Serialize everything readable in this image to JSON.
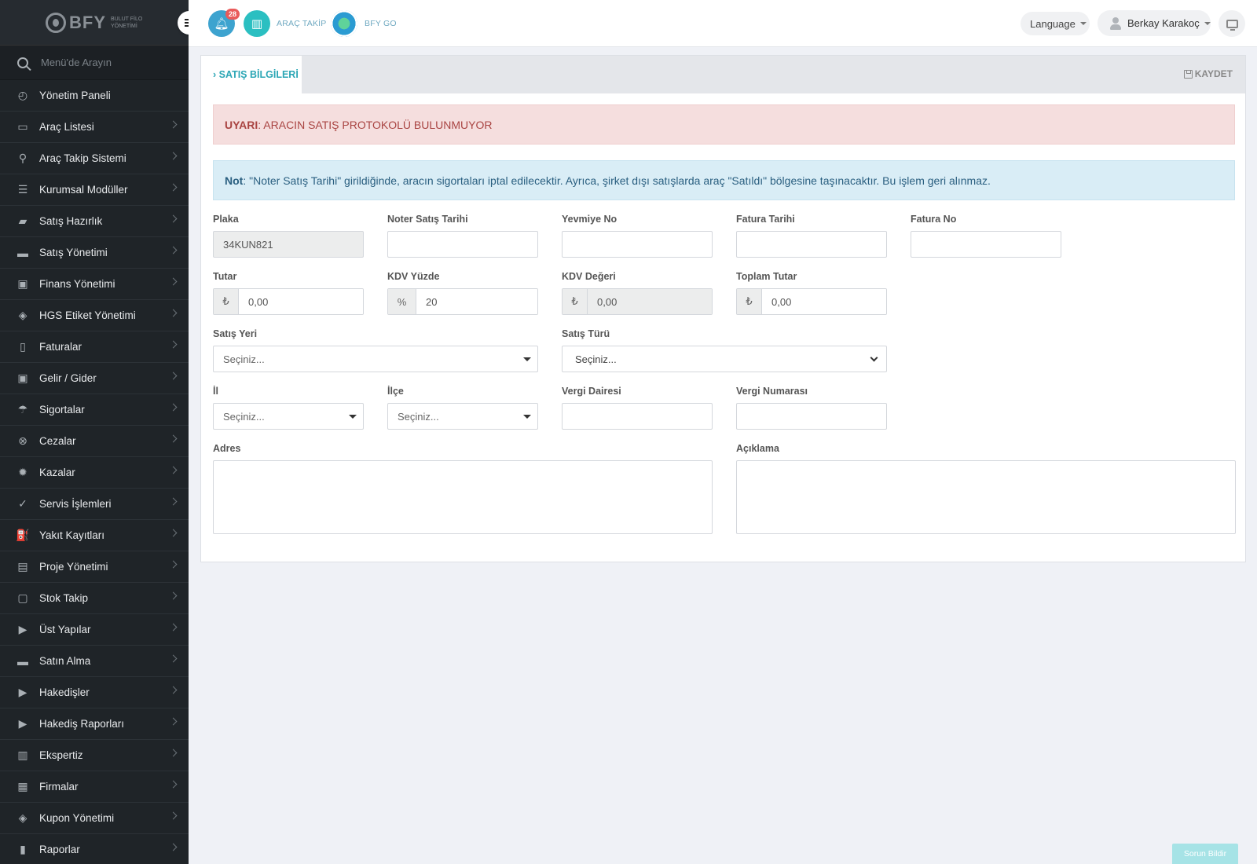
{
  "brand": {
    "name": "BFY",
    "sub_line1": "BULUT FİLO",
    "sub_line2": "YÖNETİMİ"
  },
  "sidebar": {
    "search_placeholder": "Menü'de Arayın",
    "items": [
      {
        "label": "Yönetim Paneli",
        "icon": "dashboard-icon",
        "glyph": "◴"
      },
      {
        "label": "Araç Listesi",
        "icon": "bus-icon",
        "glyph": "▭"
      },
      {
        "label": "Araç Takip Sistemi",
        "icon": "map-marker-icon",
        "glyph": "⚲"
      },
      {
        "label": "Kurumsal Modüller",
        "icon": "server-icon",
        "glyph": "☰"
      },
      {
        "label": "Satış Hazırlık",
        "icon": "book-icon",
        "glyph": "▰"
      },
      {
        "label": "Satış Yönetimi",
        "icon": "card-icon",
        "glyph": "▬"
      },
      {
        "label": "Finans Yönetimi",
        "icon": "money-icon",
        "glyph": "▣"
      },
      {
        "label": "HGS Etiket Yönetimi",
        "icon": "tag-icon",
        "glyph": "◈"
      },
      {
        "label": "Faturalar",
        "icon": "file-icon",
        "glyph": "▯"
      },
      {
        "label": "Gelir / Gider",
        "icon": "money-bill-icon",
        "glyph": "▣"
      },
      {
        "label": "Sigortalar",
        "icon": "umbrella-icon",
        "glyph": "☂"
      },
      {
        "label": "Cezalar",
        "icon": "times-circle-icon",
        "glyph": "⊗"
      },
      {
        "label": "Kazalar",
        "icon": "car-crash-icon",
        "glyph": "✹"
      },
      {
        "label": "Servis İşlemleri",
        "icon": "check-circle-icon",
        "glyph": "✓"
      },
      {
        "label": "Yakıt Kayıtları",
        "icon": "gas-pump-icon",
        "glyph": "⛽"
      },
      {
        "label": "Proje Yönetimi",
        "icon": "briefcase-icon",
        "glyph": "▤"
      },
      {
        "label": "Stok Takip",
        "icon": "inbox-icon",
        "glyph": "▢"
      },
      {
        "label": "Üst Yapılar",
        "icon": "truck-icon",
        "glyph": "▶"
      },
      {
        "label": "Satın Alma",
        "icon": "credit-card-icon",
        "glyph": "▬"
      },
      {
        "label": "Hakedişler",
        "icon": "truck-icon",
        "glyph": "▶"
      },
      {
        "label": "Hakediş Raporları",
        "icon": "truck-icon",
        "glyph": "▶"
      },
      {
        "label": "Ekspertiz",
        "icon": "clipboard-icon",
        "glyph": "▥"
      },
      {
        "label": "Firmalar",
        "icon": "building-icon",
        "glyph": "▦"
      },
      {
        "label": "Kupon Yönetimi",
        "icon": "ticket-icon",
        "glyph": "◈"
      },
      {
        "label": "Raporlar",
        "icon": "bar-chart-icon",
        "glyph": "▮"
      }
    ]
  },
  "topbar": {
    "notification_count": "28",
    "arac_takip_label": "ARAÇ TAKİP",
    "bfy_go_label": "BFY GO",
    "language_label": "Language",
    "user_name": "Berkay Karakoç"
  },
  "card": {
    "tab_label": "› SATIŞ BİLGİLERİ",
    "save_label": "KAYDET",
    "warning_prefix": "UYARI",
    "warning_text": ": ARACIN SATIŞ PROTOKOLÜ BULUNMUYOR",
    "note_prefix": "Not",
    "note_text": ": \"Noter Satış Tarihi\" girildiğinde, aracın sigortaları iptal edilecektir. Ayrıca, şirket dışı satışlarda araç \"Satıldı\" bölgesine taşınacaktır. Bu işlem geri alınmaz."
  },
  "form": {
    "plaka": {
      "label": "Plaka",
      "value": "34KUN821"
    },
    "noter_satis_tarihi": {
      "label": "Noter Satış Tarihi",
      "value": ""
    },
    "yevmiye_no": {
      "label": "Yevmiye No",
      "value": ""
    },
    "fatura_tarihi": {
      "label": "Fatura Tarihi",
      "value": ""
    },
    "fatura_no": {
      "label": "Fatura No",
      "value": ""
    },
    "tutar": {
      "label": "Tutar",
      "addon": "₺",
      "value": "0,00"
    },
    "kdv_yuzde": {
      "label": "KDV Yüzde",
      "addon": "%",
      "value": "20"
    },
    "kdv_degeri": {
      "label": "KDV Değeri",
      "addon": "₺",
      "value": "0,00"
    },
    "toplam_tutar": {
      "label": "Toplam Tutar",
      "addon": "₺",
      "value": "0,00"
    },
    "satis_yeri": {
      "label": "Satış Yeri",
      "value": "Seçiniz..."
    },
    "satis_turu": {
      "label": "Satış Türü",
      "value": "Seçiniz..."
    },
    "il": {
      "label": "İl",
      "value": "Seçiniz..."
    },
    "ilce": {
      "label": "İlçe",
      "value": "Seçiniz..."
    },
    "vergi_dairesi": {
      "label": "Vergi Dairesi",
      "value": ""
    },
    "vergi_numarasi": {
      "label": "Vergi Numarası",
      "value": ""
    },
    "adres": {
      "label": "Adres",
      "value": ""
    },
    "aciklama": {
      "label": "Açıklama",
      "value": ""
    }
  },
  "footer": {
    "report_button": "Sorun Bildir"
  },
  "colors": {
    "sidebar_bg": "#1f2428",
    "accent_teal": "#2ba6b5",
    "danger": "#a94442",
    "info": "#2a5f80"
  }
}
